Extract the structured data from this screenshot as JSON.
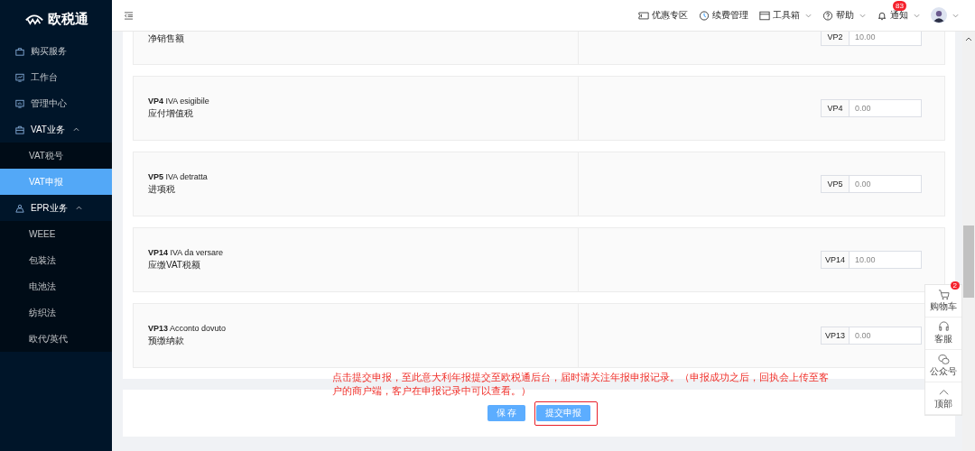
{
  "sidebar": {
    "logo": "欧税通",
    "items": [
      {
        "label": "购买服务",
        "selected": false
      },
      {
        "label": "工作台",
        "selected": false
      },
      {
        "label": "管理中心",
        "selected": false
      },
      {
        "label": "VAT业务",
        "selected": false,
        "expanded": true,
        "children": [
          {
            "label": "VAT税号",
            "selected": false
          },
          {
            "label": "VAT申报",
            "selected": true
          }
        ]
      },
      {
        "label": "EPR业务",
        "selected": false,
        "expanded": true,
        "children": [
          {
            "label": "WEEE",
            "selected": false
          },
          {
            "label": "包装法",
            "selected": false
          },
          {
            "label": "电池法",
            "selected": false
          },
          {
            "label": "纺织法",
            "selected": false
          },
          {
            "label": "欧代/英代",
            "selected": false
          }
        ]
      }
    ]
  },
  "header": {
    "tools": [
      {
        "label": "优惠专区",
        "dropdown": false
      },
      {
        "label": "续费管理",
        "dropdown": false
      },
      {
        "label": "工具箱",
        "dropdown": true
      },
      {
        "label": "帮助",
        "dropdown": true
      },
      {
        "label": "通知",
        "dropdown": true,
        "badge": "83"
      }
    ],
    "account": {
      "dropdown": true
    }
  },
  "rows": [
    {
      "subtitle": "净销售额",
      "code": "VP2",
      "value": "10.00"
    },
    {
      "title": "**VP4** IVA esigibile",
      "subtitle": "应付增值税",
      "code": "VP4",
      "value": "0.00"
    },
    {
      "title": "**VP5** IVA detratta",
      "subtitle": "进项税",
      "code": "VP5",
      "value": "0.00"
    },
    {
      "title": "**VP14** IVA da versare",
      "subtitle": "应缴VAT税额",
      "code": "VP14",
      "value": "10.00"
    },
    {
      "title": "**VP13** Acconto dovuto",
      "subtitle": "预缴纳款",
      "code": "VP13",
      "value": "0.00"
    }
  ],
  "annotation": "点击提交申报，至此意大利年报提交至欧税通后台，届时请关注年报申报记录。（申报成功之后，回执会上传至客户的商户端，客户在申报记录中可以查看。）",
  "buttons": [
    {
      "label": "保 存",
      "highlighted": false
    },
    {
      "label": "提交申报",
      "highlighted": true
    }
  ],
  "float_bar": [
    {
      "label": "购物车",
      "badge": "2"
    },
    {
      "label": "客服"
    },
    {
      "label": "公众号"
    },
    {
      "label": "顶部"
    }
  ]
}
